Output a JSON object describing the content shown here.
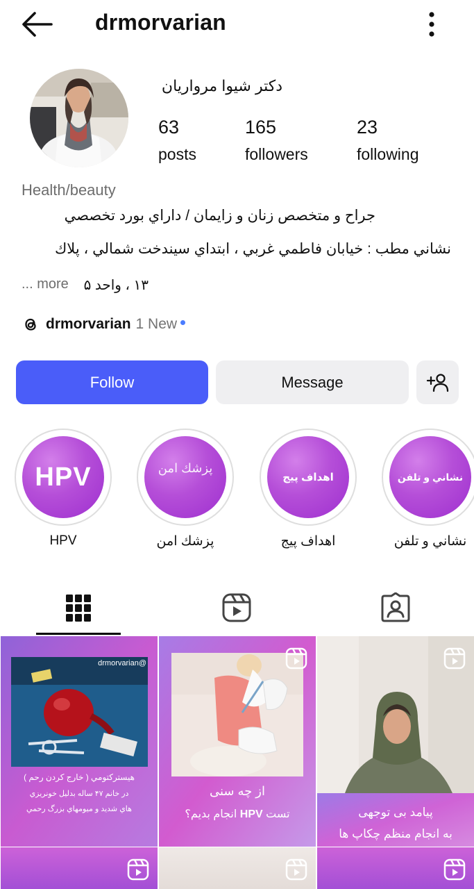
{
  "header": {
    "username": "drmorvarian"
  },
  "profile": {
    "full_name": "دکتر شیوا مرواریان",
    "stats": [
      {
        "count": "63",
        "label": "posts"
      },
      {
        "count": "165",
        "label": "followers"
      },
      {
        "count": "23",
        "label": "following"
      }
    ],
    "category": "Health/beauty",
    "bio_lines": [
      "جراح و متخصص زنان و زايمان / داراي بورد تخصصي",
      "نشاني مطب : خيابان فاطمي غربي ، ابتداي سيندخت شمالي ، پلاك",
      "۱۳ ، واحد ۵"
    ],
    "more_label": "... more",
    "threads": {
      "handle": "drmorvarian",
      "new_label": "1 New"
    }
  },
  "actions": {
    "follow_label": "Follow",
    "message_label": "Message",
    "add_user_icon": "add-user-icon"
  },
  "highlights": [
    {
      "label": "HPV",
      "cover_text": "HPV"
    },
    {
      "label": "پزشك امن",
      "cover_text": "پزشك امن"
    },
    {
      "label": "اهداف پيج",
      "cover_text": "اهداف پيج"
    },
    {
      "label": "نشاني و تلفن",
      "cover_text": "نشاني و تلفن"
    }
  ],
  "tabs": [
    {
      "icon": "grid-icon",
      "active": true
    },
    {
      "icon": "reels-icon",
      "active": false
    },
    {
      "icon": "tagged-icon",
      "active": false
    }
  ],
  "posts": [
    {
      "watermark": "@drmorvarian",
      "caption_title": "هيستركتومي ( خارج كردن رحم )",
      "caption_lines": [
        "در خانم ۴۷ ساله بدليل خونريزي",
        "هاي شديد و ميومهاي بزرگ رحمي"
      ]
    },
    {
      "caption_title": "از چه سنی",
      "caption_line2_pre": "تست",
      "caption_line2_bold": "HPV",
      "caption_line2_post": "انجام بدیم؟"
    },
    {
      "caption_lines": [
        "پیامد بی توجهی",
        "به انجام منظم چکاپ ها"
      ]
    }
  ],
  "colors": {
    "follow": "#4a5df9",
    "secondary_button": "#efeff1",
    "highlight_purple": "#b54ed8",
    "threads_dot": "#4a7cff"
  }
}
